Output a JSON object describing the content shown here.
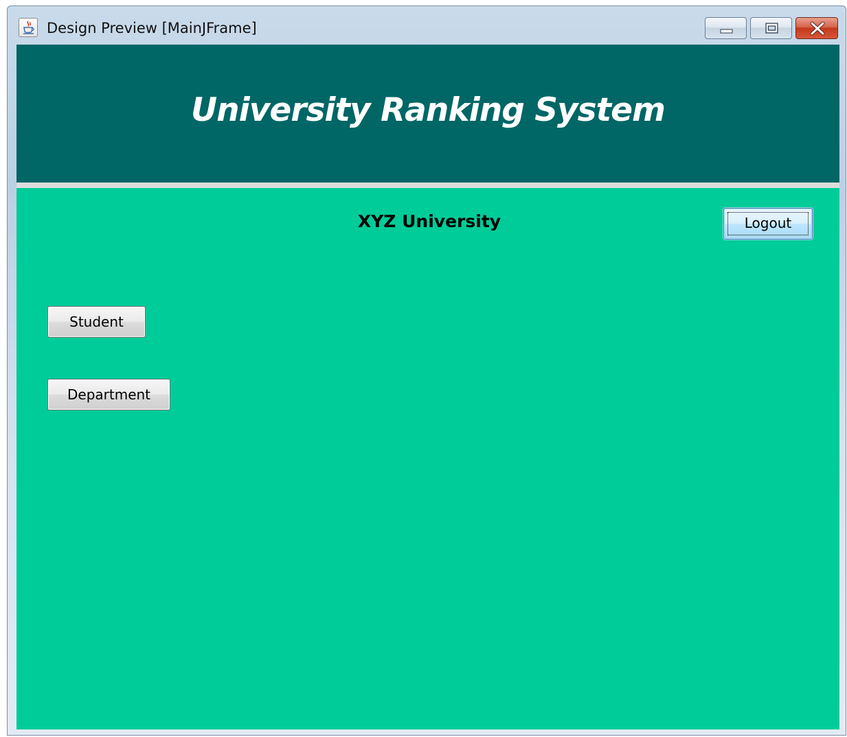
{
  "window": {
    "title": "Design Preview [MainJFrame]",
    "icon": "java-cup-icon"
  },
  "header": {
    "title": "University Ranking System",
    "background": "#006666"
  },
  "main": {
    "background": "#00cc99",
    "university_name": "XYZ University",
    "logout_label": "Logout",
    "student_label": "Student",
    "department_label": "Department"
  }
}
